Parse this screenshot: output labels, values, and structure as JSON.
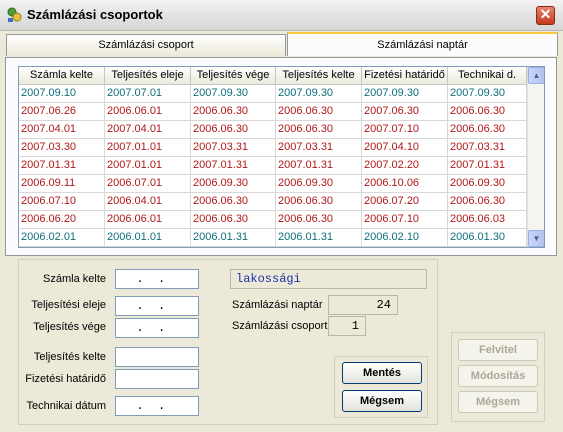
{
  "window": {
    "title": "Számlázási csoportok"
  },
  "tabs": [
    {
      "label": "Számlázási csoport",
      "active": false
    },
    {
      "label": "Számlázási naptár",
      "active": true
    }
  ],
  "grid": {
    "columns": [
      "Számla kelte",
      "Teljesítés eleje",
      "Teljesítés vége",
      "Teljesítés kelte",
      "Fizetési határidő",
      "Technikai d."
    ],
    "rows": [
      {
        "color": "#0f6e7a",
        "cells": [
          "2007.09.10",
          "2007.07.01",
          "2007.09.30",
          "2007.09.30",
          "2007.09.30",
          "2007.09.30"
        ]
      },
      {
        "color": "#b01818",
        "cells": [
          "2007.06.26",
          "2006.06.01",
          "2006.06.30",
          "2006.06.30",
          "2007.06.30",
          "2006.06.30"
        ]
      },
      {
        "color": "#b01818",
        "cells": [
          "2007.04.01",
          "2007.04.01",
          "2006.06.30",
          "2006.06.30",
          "2007.07.10",
          "2006.06.30"
        ]
      },
      {
        "color": "#b01818",
        "cells": [
          "2007.03.30",
          "2007.01.01",
          "2007.03.31",
          "2007.03.31",
          "2007.04.10",
          "2007.03.31"
        ]
      },
      {
        "color": "#b01818",
        "cells": [
          "2007.01.31",
          "2007.01.01",
          "2007.01.31",
          "2007.01.31",
          "2007.02.20",
          "2007.01.31"
        ]
      },
      {
        "color": "#b01818",
        "cells": [
          "2006.09.11",
          "2006.07.01",
          "2006.09.30",
          "2006.09.30",
          "2006.10.06",
          "2006.09.30"
        ]
      },
      {
        "color": "#b01818",
        "cells": [
          "2006.07.10",
          "2006.04.01",
          "2006.06.30",
          "2006.06.30",
          "2006.07.20",
          "2006.06.30"
        ]
      },
      {
        "color": "#b01818",
        "cells": [
          "2006.06.20",
          "2006.06.01",
          "2006.06.30",
          "2006.06.30",
          "2006.07.10",
          "2006.06.03"
        ]
      },
      {
        "color": "#0f6e7a",
        "cells": [
          "2006.02.01",
          "2006.01.01",
          "2006.01.31",
          "2006.01.31",
          "2006.02.10",
          "2006.01.30"
        ]
      }
    ]
  },
  "form": {
    "szamla_kelte_label": "Számla kelte",
    "szamla_kelte_value": "  .  .",
    "telj_eleje_label": "Teljesítési eleje",
    "telj_eleje_value": "  .  .",
    "telj_vege_label": "Teljesítés vége",
    "telj_vege_value": "  .  .",
    "telj_kelte_label": "Teljesítés kelte",
    "telj_kelte_value": "",
    "fiz_hatarido_label": "Fizetési határidő",
    "fiz_hatarido_value": "",
    "tech_datum_label": "Technikai dátum",
    "tech_datum_value": "  .  .",
    "type_value": "lakossági",
    "naptar_label": "Számlázási naptár",
    "naptar_value": "24",
    "csoport_label": "Számlázási csoport",
    "csoport_value": "1"
  },
  "buttons": {
    "save": "Mentés",
    "cancel": "Mégsem",
    "new": "Felvitel",
    "modify": "Módosítás",
    "cancel2": "Mégsem"
  },
  "colors": {
    "accent_tab": "#ffc73c",
    "row_red": "#b01818",
    "row_teal": "#0f6e7a",
    "type_text": "#1c2fa8"
  }
}
